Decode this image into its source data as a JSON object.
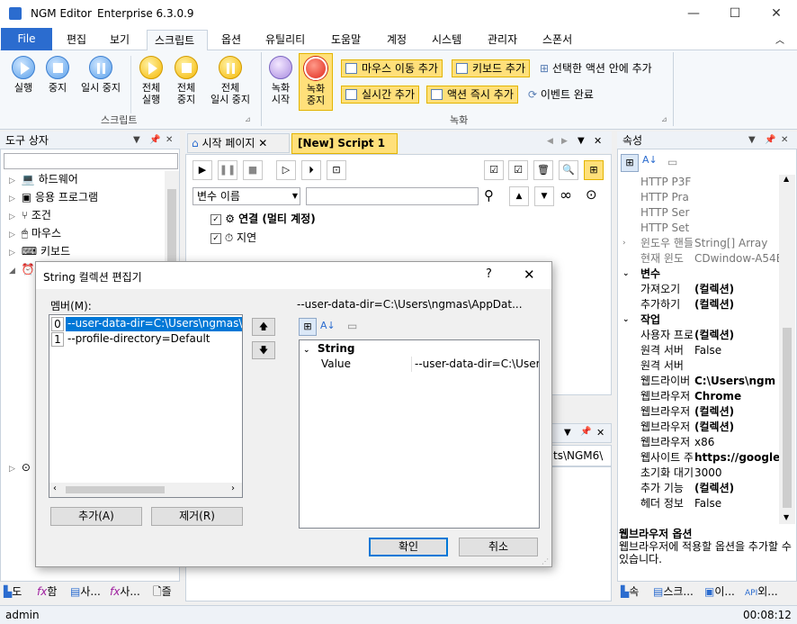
{
  "window": {
    "app": "NGM Editor",
    "edition": "Enterprise 6.3.0.9",
    "min": "—",
    "max": "☐",
    "close": "✕"
  },
  "menu": {
    "file": "File",
    "tabs": [
      "편집",
      "보기",
      "스크립트",
      "옵션",
      "유틸리티",
      "도움말",
      "계정",
      "시스템",
      "관리자",
      "스폰서"
    ]
  },
  "ribbon": {
    "run": "실행",
    "stop": "중지",
    "pause": "일시 중지",
    "full_run": [
      "전체",
      "실행"
    ],
    "full_stop": [
      "전체",
      "중지"
    ],
    "full_pause": [
      "전체",
      "일시 중지"
    ],
    "group_script": "스크립트",
    "record_start": [
      "녹화",
      "시작"
    ],
    "record_stop": [
      "녹화",
      "중지"
    ],
    "add_mouse_move": "마우스 이동 추가",
    "add_keyboard": "키보드 추가",
    "in_selected_action": "선택한 액션 안에 추가",
    "add_realtime": "실시간 추가",
    "add_action_now": "액션 즉시 추가",
    "event_done": "이벤트 완료",
    "group_record": "녹화"
  },
  "toolbox": {
    "title": "도구 상자",
    "items": [
      "하드웨어",
      "응용 프로그램",
      "조건",
      "마우스",
      "키보드"
    ],
    "bottom_tabs": [
      "도",
      "함",
      "사...",
      "사...",
      "즐"
    ]
  },
  "editor": {
    "tabs": [
      "시작 페이지",
      "[New] Script 1"
    ],
    "var_select": "변수 이름",
    "lines": [
      "연결 (멀티 계정)",
      "지연"
    ],
    "lower_path": "ts\\NGM6\\"
  },
  "properties": {
    "title": "속성",
    "rows": [
      {
        "k": "HTTP P3F",
        "v": ""
      },
      {
        "k": "HTTP Pra",
        "v": ""
      },
      {
        "k": "HTTP Ser",
        "v": ""
      },
      {
        "k": "HTTP Set",
        "v": ""
      },
      {
        "k": "윈도우 핸들",
        "v": "String[] Array"
      },
      {
        "k": "현재 윈도",
        "v": "CDwindow-A54B"
      }
    ],
    "cat_var": "변수",
    "var_rows": [
      {
        "k": "가져오기",
        "v": "(컬렉션)"
      },
      {
        "k": "추가하기",
        "v": "(컬렉션)"
      }
    ],
    "cat_work": "작업",
    "work_rows": [
      {
        "k": "사용자 프로",
        "v": "(컬렉션)"
      },
      {
        "k": "원격 서버",
        "v": "False"
      },
      {
        "k": "원격 서버",
        "v": ""
      },
      {
        "k": "웹드라이버",
        "v": "C:\\Users\\ngm"
      },
      {
        "k": "웹브라우저",
        "v": "Chrome"
      },
      {
        "k": "웹브라우저",
        "v": "(컬렉션)"
      },
      {
        "k": "웹브라우저",
        "v": "(컬렉션)"
      },
      {
        "k": "웹브라우저",
        "v": "x86"
      },
      {
        "k": "웹사이트 주",
        "v": "https://google"
      },
      {
        "k": "초기화 대기",
        "v": "3000"
      },
      {
        "k": "추가 기능",
        "v": "(컬렉션)"
      },
      {
        "k": "헤더 정보",
        "v": "False"
      }
    ],
    "desc_title": "웹브라우저 옵션",
    "desc_text": "웹브라우저에 적용할 옵션을 추가할 수 있습니다.",
    "bottom_tabs": [
      "속",
      "스크...",
      "이...",
      "외..."
    ]
  },
  "dialog": {
    "title": "String 컬렉션 편집기",
    "help": "?",
    "close": "✕",
    "members_label": "멤버(M):",
    "members": [
      {
        "index": "0",
        "text": "--user-data-dir=C:\\Users\\ngmas\\AppData"
      },
      {
        "index": "1",
        "text": "--profile-directory=Default"
      }
    ],
    "preview_label": "--user-data-dir=C:\\Users\\ngmas\\AppDat...",
    "add": "추가(A)",
    "remove": "제거(R)",
    "prop_category": "String",
    "prop_name": "Value",
    "prop_value": "--user-data-dir=C:\\Users\\ngmas\\AppData",
    "ok": "확인",
    "cancel": "취소"
  },
  "status": {
    "user": "admin",
    "time": "00:08:12"
  }
}
